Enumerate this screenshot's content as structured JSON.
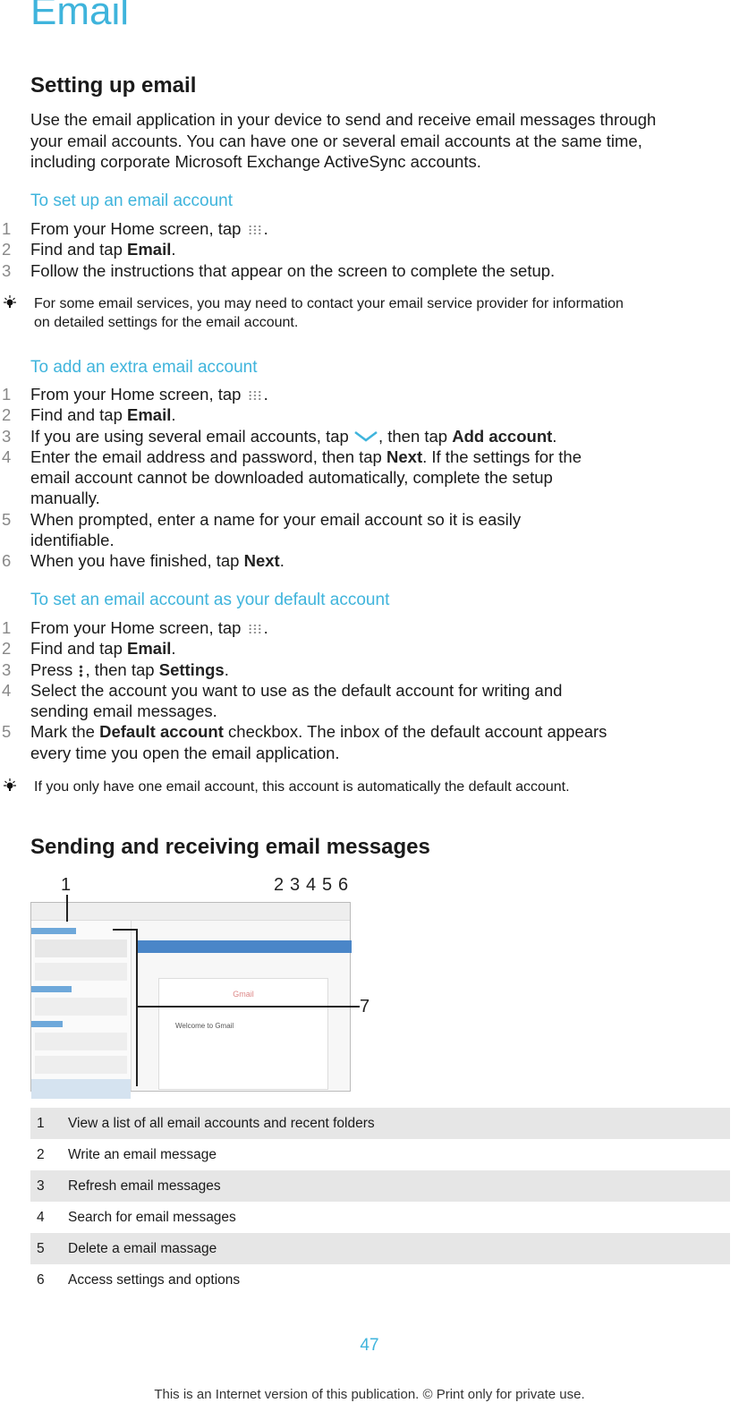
{
  "title": "Email",
  "section1": {
    "heading": "Setting up email",
    "intro": [
      "Use the email application in your device to send and receive email messages through",
      "your email accounts. You can have one or several email accounts at the same time,",
      "including corporate Microsoft Exchange ActiveSync accounts."
    ]
  },
  "setup": {
    "heading": "To set up an email account",
    "s1": "From your Home screen, tap ",
    "s2a": "Find and tap ",
    "email": "Email",
    "s3": "Follow the instructions that appear on the screen to complete the setup.",
    "tip": [
      "For some email services, you may need to contact your email service provider for information",
      "on detailed settings for the email account."
    ]
  },
  "extra": {
    "heading": "To add an extra email account",
    "s3a": "If you are using several email accounts, tap ",
    "s3b": ", then tap ",
    "add": "Add account",
    "s4a": "Enter the email address and password, then tap ",
    "next": "Next",
    "s4b": ". If the settings for the",
    "s4c": "email account cannot be downloaded automatically, complete the setup",
    "s4d": "manually.",
    "s5a": "When prompted, enter a name for your email account so it is easily",
    "s5b": "identifiable.",
    "s6a": "When you have finished, tap "
  },
  "default": {
    "heading": "To set an email account as your default account",
    "s3a": "Press ",
    "s3b": ", then tap ",
    "settings": "Settings",
    "s4a": "Select the account you want to use as the default account for writing and",
    "s4b": "sending email messages.",
    "s5a": "Mark the ",
    "da": "Default account",
    "s5b": " checkbox. The inbox of the default account appears",
    "s5c": "every time you open the email application.",
    "tip": "If you only have one email account, this account is automatically the default account."
  },
  "section2": {
    "heading": "Sending and receiving email messages",
    "image": {
      "callouts": [
        "1",
        "2",
        "3",
        "4",
        "5",
        "6",
        "7"
      ],
      "brand": "Gmail",
      "welcome": "Welcome to Gmail"
    },
    "legend": [
      {
        "n": "1",
        "t": "View a list of all email accounts and recent folders"
      },
      {
        "n": "2",
        "t": "Write an email message"
      },
      {
        "n": "3",
        "t": "Refresh email messages"
      },
      {
        "n": "4",
        "t": "Search for email messages"
      },
      {
        "n": "5",
        "t": "Delete a email massage"
      },
      {
        "n": "6",
        "t": "Access settings and options"
      }
    ]
  },
  "footer": {
    "page": "47",
    "note": "This is an Internet version of this publication. © Print only for private use."
  },
  "nums": [
    "1",
    "2",
    "3",
    "4",
    "5",
    "6",
    "."
  ],
  "colors": {
    "accent": "#3fb4dc",
    "row_shade": "#e6e6e6"
  }
}
